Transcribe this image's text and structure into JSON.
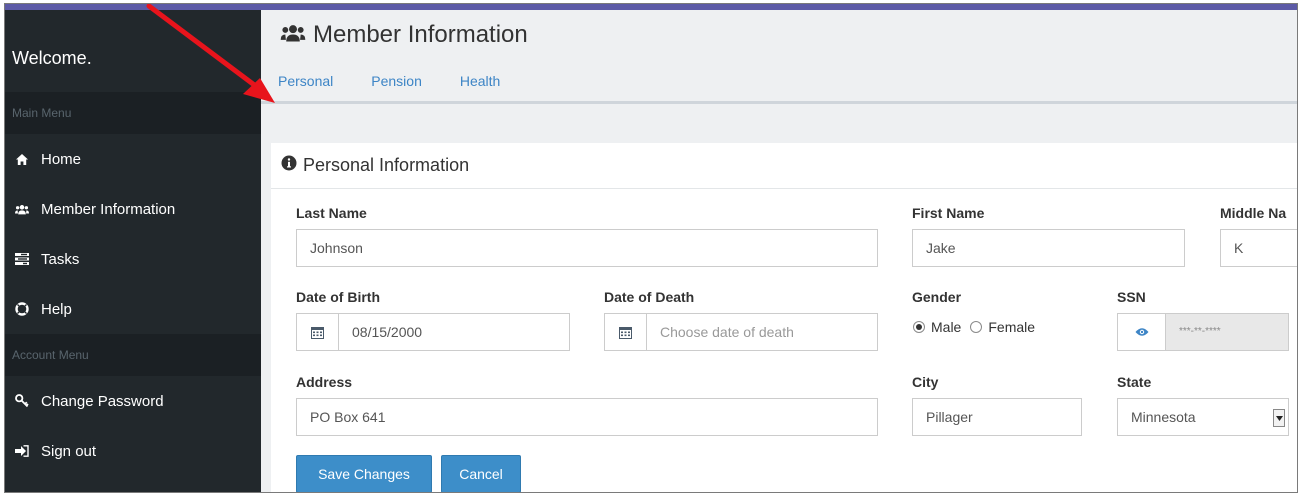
{
  "sidebar": {
    "welcome": "Welcome.",
    "main_menu_header": "Main Menu",
    "items": [
      {
        "label": "Home",
        "icon": "home-icon"
      },
      {
        "label": "Member Information",
        "icon": "users-icon"
      },
      {
        "label": "Tasks",
        "icon": "tasks-icon"
      },
      {
        "label": "Help",
        "icon": "lifebuoy-icon"
      }
    ],
    "account_menu_header": "Account Menu",
    "account_items": [
      {
        "label": "Change Password",
        "icon": "key-icon"
      },
      {
        "label": "Sign out",
        "icon": "sign-out-icon"
      }
    ]
  },
  "page": {
    "title": "Member Information",
    "tabs": [
      "Personal",
      "Pension",
      "Health"
    ]
  },
  "card": {
    "title": "Personal Information"
  },
  "form": {
    "last_name_label": "Last Name",
    "last_name_value": "Johnson",
    "first_name_label": "First Name",
    "first_name_value": "Jake",
    "middle_name_label": "Middle Na",
    "middle_name_value": "K",
    "dob_label": "Date of Birth",
    "dob_value": "08/15/2000",
    "dod_label": "Date of Death",
    "dod_placeholder": "Choose date of death",
    "gender_label": "Gender",
    "gender_male": "Male",
    "gender_female": "Female",
    "gender_selected": "Male",
    "ssn_label": "SSN",
    "ssn_value": "***-**-****",
    "address_label": "Address",
    "address_value": "PO Box 641",
    "city_label": "City",
    "city_value": "Pillager",
    "state_label": "State",
    "state_value": "Minnesota"
  },
  "buttons": {
    "save": "Save Changes",
    "cancel": "Cancel"
  },
  "colors": {
    "topbar": "#5c5aa6",
    "sidebar": "#22282c",
    "link": "#3d85c6",
    "button": "#3d8ec9",
    "annotation_arrow": "#e8141c"
  }
}
